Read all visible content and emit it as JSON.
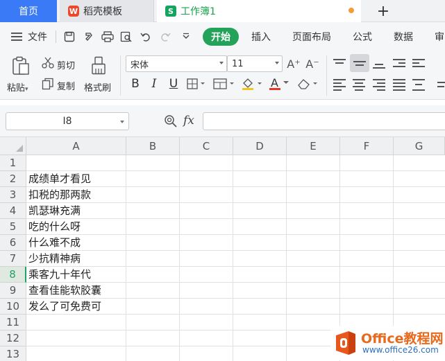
{
  "tabs": {
    "home": "首页",
    "template": "稻壳模板",
    "workbook": "工作簿1",
    "new_tab": "+"
  },
  "menu": {
    "file": "文件",
    "start": "开始",
    "insert": "插入",
    "page_layout": "页面布局",
    "formulas": "公式",
    "data": "数据",
    "review_partial": "审"
  },
  "ribbon": {
    "paste": "粘贴",
    "cut": "剪切",
    "copy": "复制",
    "format_painter": "格式刷",
    "font_name": "宋体",
    "font_size": "11",
    "bold": "B",
    "italic": "I",
    "underline": "U",
    "font_color_letter": "A",
    "grow_font": "A⁺",
    "shrink_font": "A⁻"
  },
  "formula_bar": {
    "name_box": "I8",
    "fx": "fx",
    "formula": ""
  },
  "grid": {
    "columns": [
      "A",
      "B",
      "C",
      "D",
      "E",
      "F",
      "G"
    ],
    "rows": [
      "1",
      "2",
      "3",
      "4",
      "5",
      "6",
      "7",
      "8",
      "9",
      "10",
      "11",
      "12",
      "13"
    ],
    "active_row": "8",
    "cells_A": [
      "",
      "成绩单才看见",
      "扣税的那两款",
      "凯瑟琳充满",
      "吃的什么呀",
      "什么难不成",
      "少抗精神病",
      "乘客九十年代",
      "查看佳能软胶囊",
      "发么了可免费可",
      "",
      "",
      ""
    ]
  },
  "watermark": {
    "title": "Office教程网",
    "url": "www.office26.com"
  },
  "colors": {
    "accent_green": "#21a366",
    "home_tab_blue": "#3a7af6",
    "watermark_orange": "#e86a1c"
  }
}
